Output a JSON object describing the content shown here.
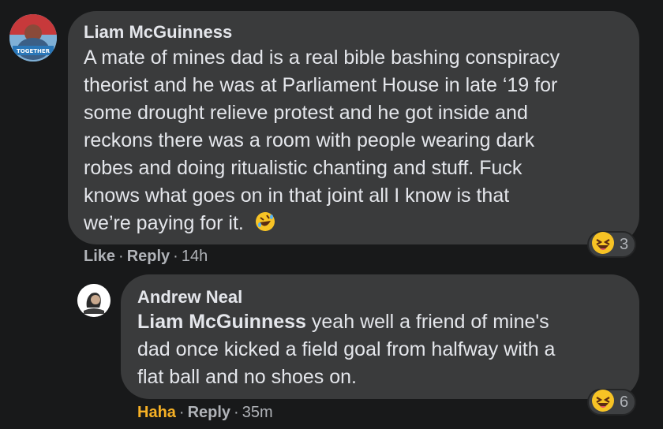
{
  "comments": [
    {
      "author": "Liam McGuinness",
      "avatar_badge": "TOGETHER",
      "lines": [
        "A mate of mines dad is a real bible bashing conspiracy",
        "theorist and he was at Parliament House in late ‘19 for",
        "some drought relieve protest and he got inside and",
        "reckons there was a room with people wearing dark",
        "robes and doing ritualistic chanting and stuff. Fuck",
        "knows what goes on in that joint all I know is that",
        "we’re paying for it."
      ],
      "reaction": {
        "icon": "laughing-emoji",
        "count": "3"
      },
      "actions": {
        "primary": "Like",
        "reply": "Reply",
        "time": "14h"
      }
    },
    {
      "author": "Andrew Neal",
      "mention": "Liam McGuinness",
      "lines": [
        "yeah well a friend of mine's",
        "dad once kicked a field goal from halfway with a",
        "flat ball and no shoes on."
      ],
      "reaction": {
        "icon": "laughing-emoji",
        "count": "6"
      },
      "actions": {
        "primary": "Haha",
        "reply": "Reply",
        "time": "35m"
      }
    }
  ],
  "colors": {
    "background": "#18191a",
    "bubble": "#3a3b3c",
    "text": "#e4e6eb",
    "secondary": "#b0b3b8",
    "haha": "#f7b125"
  }
}
